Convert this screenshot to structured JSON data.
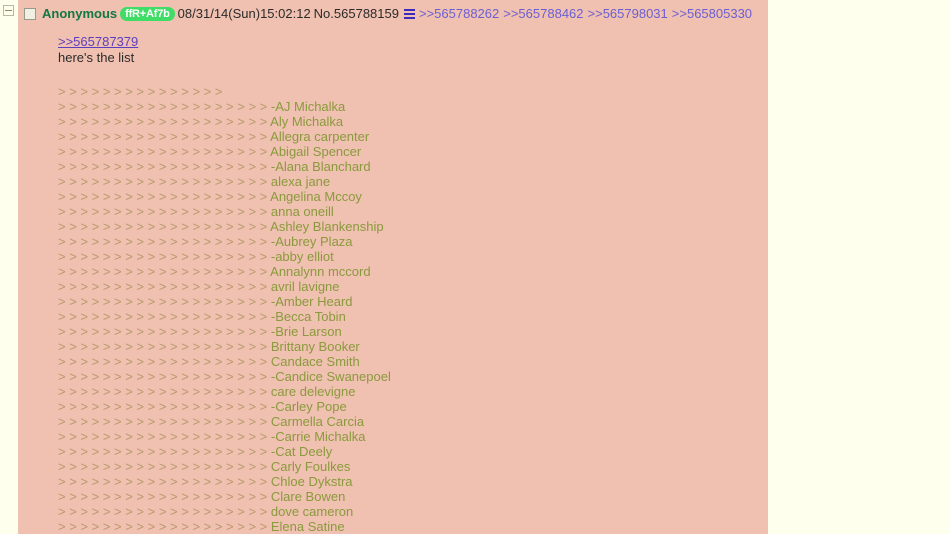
{
  "page": {
    "background_color": "#ffffee",
    "post_background_color": "#f0c0b0"
  },
  "collapse": {
    "label": "-",
    "name": "collapse-thread-toggle"
  },
  "post": {
    "checkbox_checked": false,
    "poster_name": "Anonymous",
    "tripcode": "ffR+Af7b",
    "tripcode_color": "#3fdc66",
    "date": "08/31/14(Sun)15:02:12",
    "post_number": "No.565788159",
    "menu_icon": "hamburger-icon",
    "backlinks": [
      ">>565788262",
      ">>565788462",
      ">>565798031",
      ">>565805330"
    ],
    "quote_link": ">>565787379",
    "intro_text": "here's the list",
    "name_color": "#117743",
    "quote_color": "#5c3fbd",
    "greentext_color": "#8a9a3c"
  },
  "list": {
    "header_marks": "> > > > > > > > > > > > > > >",
    "lines": [
      {
        "marks": "> > > > > > > > > > > > > > > > > > >",
        "name": "-AJ Michalka"
      },
      {
        "marks": "> > > > > > > > > > > > > > > > > > >",
        "name": "Aly Michalka"
      },
      {
        "marks": "> > > > > > > > > > > > > > > > > > >",
        "name": "Allegra carpenter"
      },
      {
        "marks": "> > > > > > > > > > > > > > > > > > >",
        "name": "Abigail Spencer"
      },
      {
        "marks": "> > > > > > > > > > > > > > > > > > >",
        "name": "-Alana Blanchard"
      },
      {
        "marks": "> > > > > > > > > > > > > > > > > > >",
        "name": "alexa jane"
      },
      {
        "marks": "> > > > > > > > > > > > > > > > > > >",
        "name": "Angelina Mccoy"
      },
      {
        "marks": "> > > > > > > > > > > > > > > > > > >",
        "name": "anna oneill"
      },
      {
        "marks": "> > > > > > > > > > > > > > > > > > >",
        "name": "Ashley Blankenship"
      },
      {
        "marks": "> > > > > > > > > > > > > > > > > > >",
        "name": "-Aubrey Plaza"
      },
      {
        "marks": "> > > > > > > > > > > > > > > > > > >",
        "name": "-abby elliot"
      },
      {
        "marks": "> > > > > > > > > > > > > > > > > > >",
        "name": "Annalynn mccord"
      },
      {
        "marks": "> > > > > > > > > > > > > > > > > > >",
        "name": "avril lavigne"
      },
      {
        "marks": "> > > > > > > > > > > > > > > > > > >",
        "name": "-Amber Heard"
      },
      {
        "marks": "> > > > > > > > > > > > > > > > > > >",
        "name": "-Becca Tobin"
      },
      {
        "marks": "> > > > > > > > > > > > > > > > > > >",
        "name": "-Brie Larson"
      },
      {
        "marks": "> > > > > > > > > > > > > > > > > > >",
        "name": "Brittany Booker"
      },
      {
        "marks": "> > > > > > > > > > > > > > > > > > >",
        "name": "Candace Smith"
      },
      {
        "marks": "> > > > > > > > > > > > > > > > > > >",
        "name": "-Candice Swanepoel"
      },
      {
        "marks": "> > > > > > > > > > > > > > > > > > >",
        "name": "care delevigne"
      },
      {
        "marks": "> > > > > > > > > > > > > > > > > > >",
        "name": "-Carley Pope"
      },
      {
        "marks": "> > > > > > > > > > > > > > > > > > >",
        "name": "Carmella Carcia"
      },
      {
        "marks": "> > > > > > > > > > > > > > > > > > >",
        "name": "-Carrie Michalka"
      },
      {
        "marks": "> > > > > > > > > > > > > > > > > > >",
        "name": "-Cat Deely"
      },
      {
        "marks": "> > > > > > > > > > > > > > > > > > >",
        "name": "Carly Foulkes"
      },
      {
        "marks": "> > > > > > > > > > > > > > > > > > >",
        "name": "Chloe Dykstra"
      },
      {
        "marks": "> > > > > > > > > > > > > > > > > > >",
        "name": "Clare Bowen"
      },
      {
        "marks": "> > > > > > > > > > > > > > > > > > >",
        "name": "dove cameron"
      },
      {
        "marks": "> > > > > > > > > > > > > > > > > > >",
        "name": "Elena Satine"
      }
    ]
  }
}
